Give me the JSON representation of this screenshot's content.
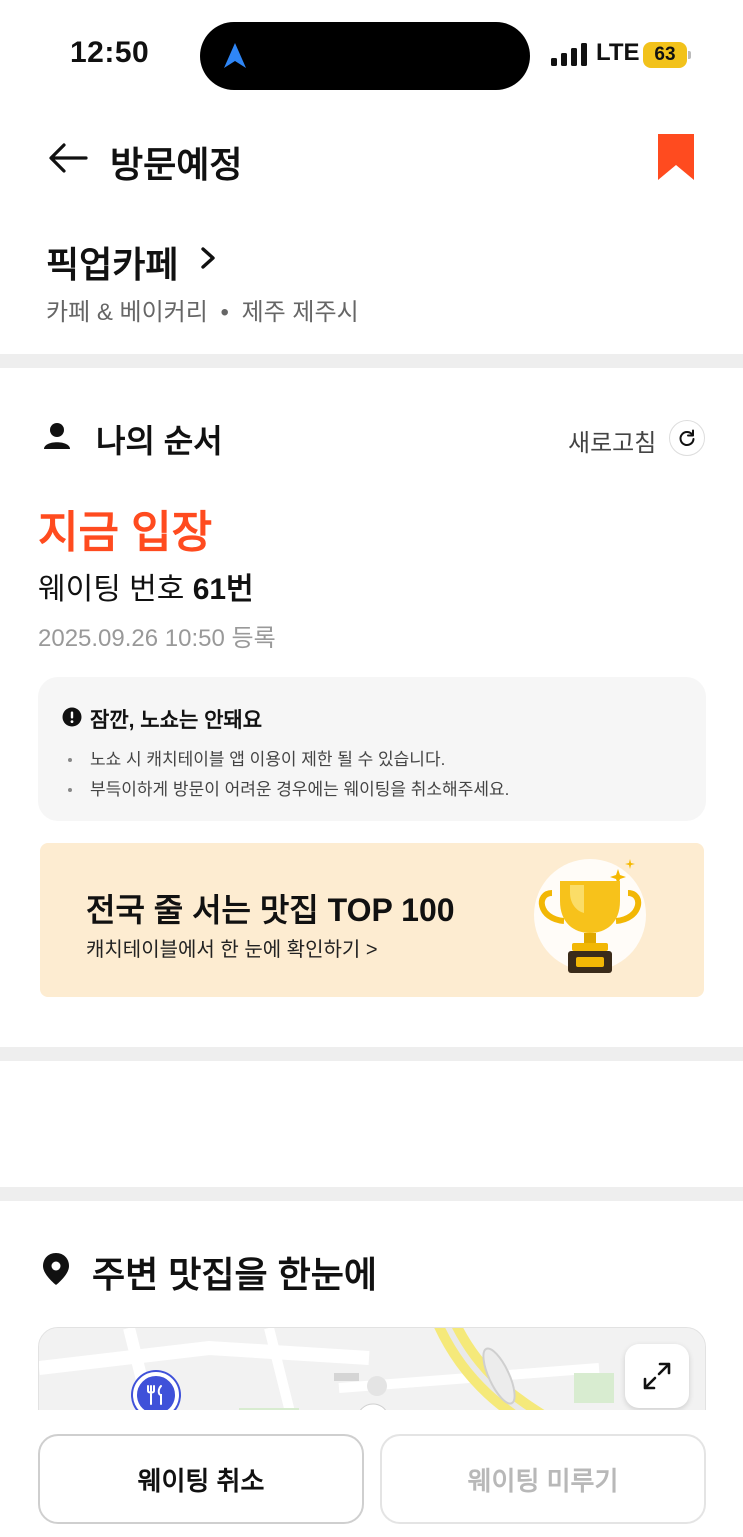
{
  "status_bar": {
    "time": "12:50",
    "network": "LTE",
    "battery": "63",
    "battery_color": "#f2c21b"
  },
  "header": {
    "title": "방문예정",
    "back_icon": "arrow-left-icon",
    "bookmark_icon": "bookmark-icon",
    "bookmark_color": "#ff4b1f"
  },
  "store": {
    "name": "픽업카페",
    "category": "카페 & 베이커리",
    "location": "제주 제주시"
  },
  "my_order": {
    "title": "나의 순서",
    "refresh_label": "새로고침",
    "status": "지금 입장",
    "status_color": "#ff4b1f",
    "waiting_prefix": "웨이팅 번호",
    "waiting_number": "61번",
    "registered_at": "2025.09.26 10:50 등록"
  },
  "notice": {
    "title": "잠깐, 노쇼는 안돼요",
    "items": [
      "노쇼 시 캐치테이블 앱 이용이 제한 될 수 있습니다.",
      "부득이하게 방문이 어려운 경우에는 웨이팅을 취소해주세요."
    ]
  },
  "banner": {
    "title": "전국 줄 서는 맛집 TOP 100",
    "subtitle": "캐치테이블에서 한 눈에 확인하기 >",
    "trophy_label": "TOP 100",
    "background": "#fdecd1"
  },
  "nearby": {
    "title": "주변 맛집을 한눈에"
  },
  "actions": {
    "cancel_label": "웨이팅 취소",
    "postpone_label": "웨이팅 미루기"
  }
}
